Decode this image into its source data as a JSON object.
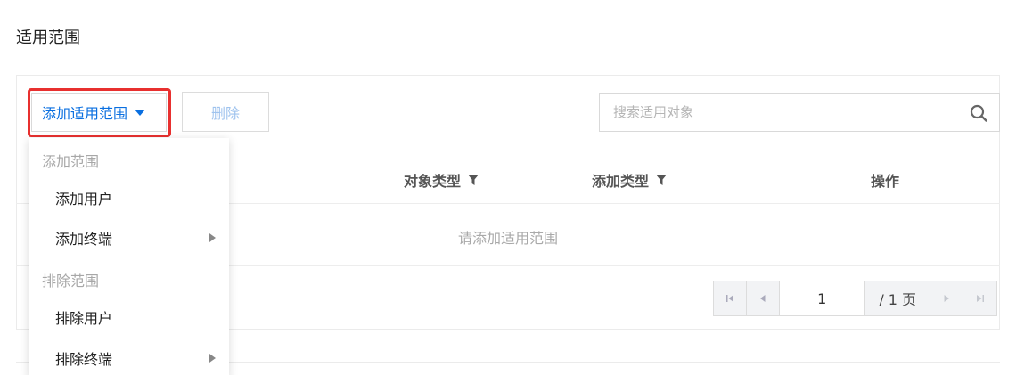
{
  "section": {
    "title": "适用范围"
  },
  "toolbar": {
    "add_label": "添加适用范围",
    "delete_label": "删除"
  },
  "search": {
    "placeholder": "搜索适用对象",
    "value": ""
  },
  "table": {
    "columns": [
      "对象类型",
      "添加类型",
      "操作"
    ],
    "empty_text": "请添加适用范围"
  },
  "pagination": {
    "current_page": "1",
    "total_label": "/ 1 页"
  },
  "dropdown": {
    "groups": [
      {
        "label": "添加范围",
        "items": [
          {
            "label": "添加用户",
            "has_submenu": false
          },
          {
            "label": "添加终端",
            "has_submenu": true
          }
        ]
      },
      {
        "label": "排除范围",
        "items": [
          {
            "label": "排除用户",
            "has_submenu": false
          },
          {
            "label": "排除终端",
            "has_submenu": true
          }
        ]
      }
    ]
  },
  "colors": {
    "accent": "#0a6fe0",
    "highlight": "#e8302f",
    "muted": "#a9a9a9"
  },
  "icons": {
    "search": "search-icon",
    "filter": "filter-icon",
    "caret": "caret-down-icon",
    "submenu": "chevron-right-icon"
  }
}
